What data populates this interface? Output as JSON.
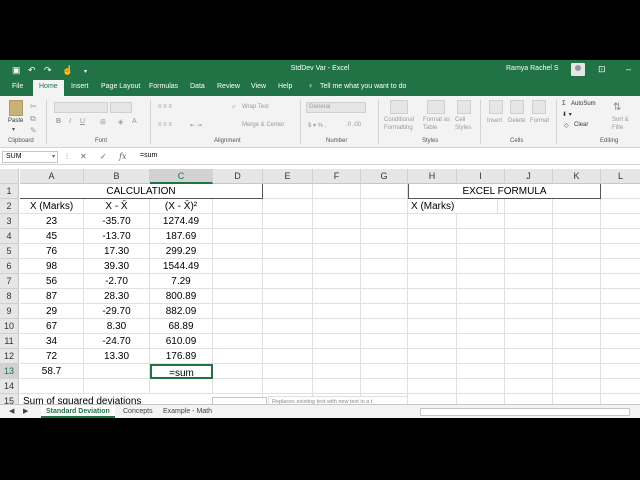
{
  "titlebar": {
    "document_title": "StdDev Var  -  Excel",
    "user_name": "Ramya Rachel S"
  },
  "tabs": [
    "File",
    "Home",
    "Insert",
    "Page Layout",
    "Formulas",
    "Data",
    "Review",
    "View",
    "Help",
    "Tell me what you want to do"
  ],
  "ribbon": {
    "paste_label": "Paste",
    "clipboard_group": "Clipboard",
    "font_group": "Font",
    "wrap_text": "Wrap Text",
    "merge_center": "Merge & Center",
    "alignment_group": "Alignment",
    "number_format": "General",
    "number_group": "Number",
    "conditional_formatting": "Conditional Formatting",
    "format_as_table": "Format as Table",
    "cell_styles": "Cell Styles",
    "styles_group": "Styles",
    "insert": "Insert",
    "delete": "Delete",
    "format": "Format",
    "cells_group": "Cells",
    "autosum": "AutoSum",
    "clear": "Clear",
    "sort_filter": "Sort & Filte",
    "editing_group": "Editing"
  },
  "formula_bar": {
    "name_box": "SUM",
    "fx": "fx",
    "formula": "=sum"
  },
  "columns": [
    "A",
    "B",
    "C",
    "D",
    "E",
    "F",
    "G",
    "H",
    "I",
    "J",
    "K",
    "L"
  ],
  "rows": [
    "1",
    "2",
    "3",
    "4",
    "5",
    "6",
    "7",
    "8",
    "9",
    "10",
    "11",
    "12",
    "13",
    "14",
    "15"
  ],
  "sheet": {
    "calc_title": "CALCULATION",
    "excel_formula_title": "EXCEL FORMULA",
    "hdr_a": "X (Marks)",
    "hdr_b": "X - X̄",
    "hdr_c": "(X - X̄)²",
    "hdr_h": "X (Marks)",
    "data": [
      [
        "23",
        "-35.70",
        "1274.49"
      ],
      [
        "45",
        "-13.70",
        "187.69"
      ],
      [
        "76",
        "17.30",
        "299.29"
      ],
      [
        "98",
        "39.30",
        "1544.49"
      ],
      [
        "56",
        "-2.70",
        "7.29"
      ],
      [
        "87",
        "28.30",
        "800.89"
      ],
      [
        "29",
        "-29.70",
        "882.09"
      ],
      [
        "67",
        "8.30",
        "68.89"
      ],
      [
        "34",
        "-24.70",
        "610.09"
      ],
      [
        "72",
        "13.30",
        "176.89"
      ]
    ],
    "a13": "58.7",
    "c13": "=sum",
    "a15": "Sum of squared deviations",
    "tooltip": "Replaces existing text with new text in a t"
  },
  "sheet_tabs": [
    "Standard Deviation",
    "Concepts",
    "Example - Math"
  ]
}
